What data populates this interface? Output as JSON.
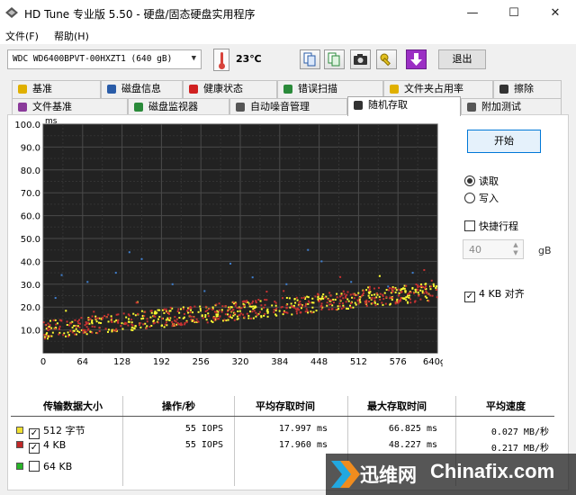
{
  "window": {
    "title": "HD Tune 专业版 5.50 - 硬盘/固态硬盘实用程序"
  },
  "menu": {
    "file": "文件(F)",
    "help": "帮助(H)"
  },
  "toolbar": {
    "drive": "WDC WD6400BPVT-00HXZT1 (640 gB)",
    "temperature": "23℃",
    "exit_label": "退出"
  },
  "tabs_row1": [
    {
      "label": "基准",
      "icon": "benchmark-icon"
    },
    {
      "label": "磁盘信息",
      "icon": "info-icon"
    },
    {
      "label": "健康状态",
      "icon": "health-icon"
    },
    {
      "label": "错误扫描",
      "icon": "search-icon"
    },
    {
      "label": "文件夹占用率",
      "icon": "folder-icon"
    },
    {
      "label": "擦除",
      "icon": "erase-icon"
    }
  ],
  "tabs_row2": [
    {
      "label": "文件基准",
      "icon": "file-benchmark-icon"
    },
    {
      "label": "磁盘监视器",
      "icon": "monitor-icon"
    },
    {
      "label": "自动噪音管理",
      "icon": "speaker-icon"
    },
    {
      "label": "随机存取",
      "icon": "random-access-icon",
      "active": true
    },
    {
      "label": "附加测试",
      "icon": "extra-tests-icon"
    }
  ],
  "controls": {
    "start_label": "开始",
    "read_label": "读取",
    "write_label": "写入",
    "read_selected": true,
    "short_stroke_label": "快捷行程",
    "short_stroke_checked": false,
    "short_stroke_value": "40",
    "short_stroke_unit": "gB",
    "align_label": "4 KB 对齐",
    "align_checked": true
  },
  "chart_data": {
    "type": "scatter",
    "ylabel": "ms",
    "ylim": [
      0,
      100
    ],
    "xlim": [
      0,
      640
    ],
    "x_unit": "gB",
    "y_ticks": [
      "100.0",
      "90.0",
      "80.0",
      "70.0",
      "60.0",
      "50.0",
      "40.0",
      "30.0",
      "20.0",
      "10.0"
    ],
    "x_ticks": [
      "0",
      "64",
      "128",
      "192",
      "256",
      "320",
      "384",
      "448",
      "512",
      "576",
      "640gB"
    ],
    "grid": true,
    "background": "#222222",
    "series": [
      {
        "name": "512 字节",
        "color": "#ffff33",
        "trend": [
          [
            0,
            10
          ],
          [
            640,
            27
          ]
        ],
        "spread": 8,
        "count": 420
      },
      {
        "name": "4 KB",
        "color": "#c83232",
        "trend": [
          [
            0,
            10
          ],
          [
            640,
            27
          ]
        ],
        "spread": 8,
        "count": 420
      },
      {
        "name": "64 KB",
        "color": "#4080d0",
        "outliers": [
          [
            30,
            34
          ],
          [
            72,
            31
          ],
          [
            118,
            35
          ],
          [
            160,
            41
          ],
          [
            210,
            30
          ],
          [
            262,
            27
          ],
          [
            304,
            39
          ],
          [
            340,
            33
          ],
          [
            395,
            30
          ],
          [
            452,
            40
          ],
          [
            500,
            31
          ],
          [
            560,
            29
          ],
          [
            600,
            35
          ],
          [
            20,
            24
          ],
          [
            140,
            44
          ],
          [
            430,
            45
          ]
        ]
      }
    ]
  },
  "results": {
    "headers": [
      "传输数据大小",
      "操作/秒",
      "平均存取时间",
      "最大存取时间",
      "平均速度"
    ],
    "rows": [
      {
        "label": "512 字节",
        "color": "#f0e030",
        "checked": true,
        "iops": "55 IOPS",
        "avg": "17.997 ms",
        "max": "66.825 ms",
        "speed": "0.027 MB/秒"
      },
      {
        "label": "4 KB",
        "color": "#c02828",
        "checked": true,
        "iops": "55 IOPS",
        "avg": "17.960 ms",
        "max": "48.227 ms",
        "speed": "0.217 MB/秒"
      },
      {
        "label": "64 KB",
        "color": "#28b428",
        "checked": false,
        "iops": "",
        "avg": "",
        "max": "",
        "speed": ""
      }
    ]
  },
  "watermark": {
    "brand_cn": "迅维网",
    "brand_en": "Chinafix.com"
  }
}
